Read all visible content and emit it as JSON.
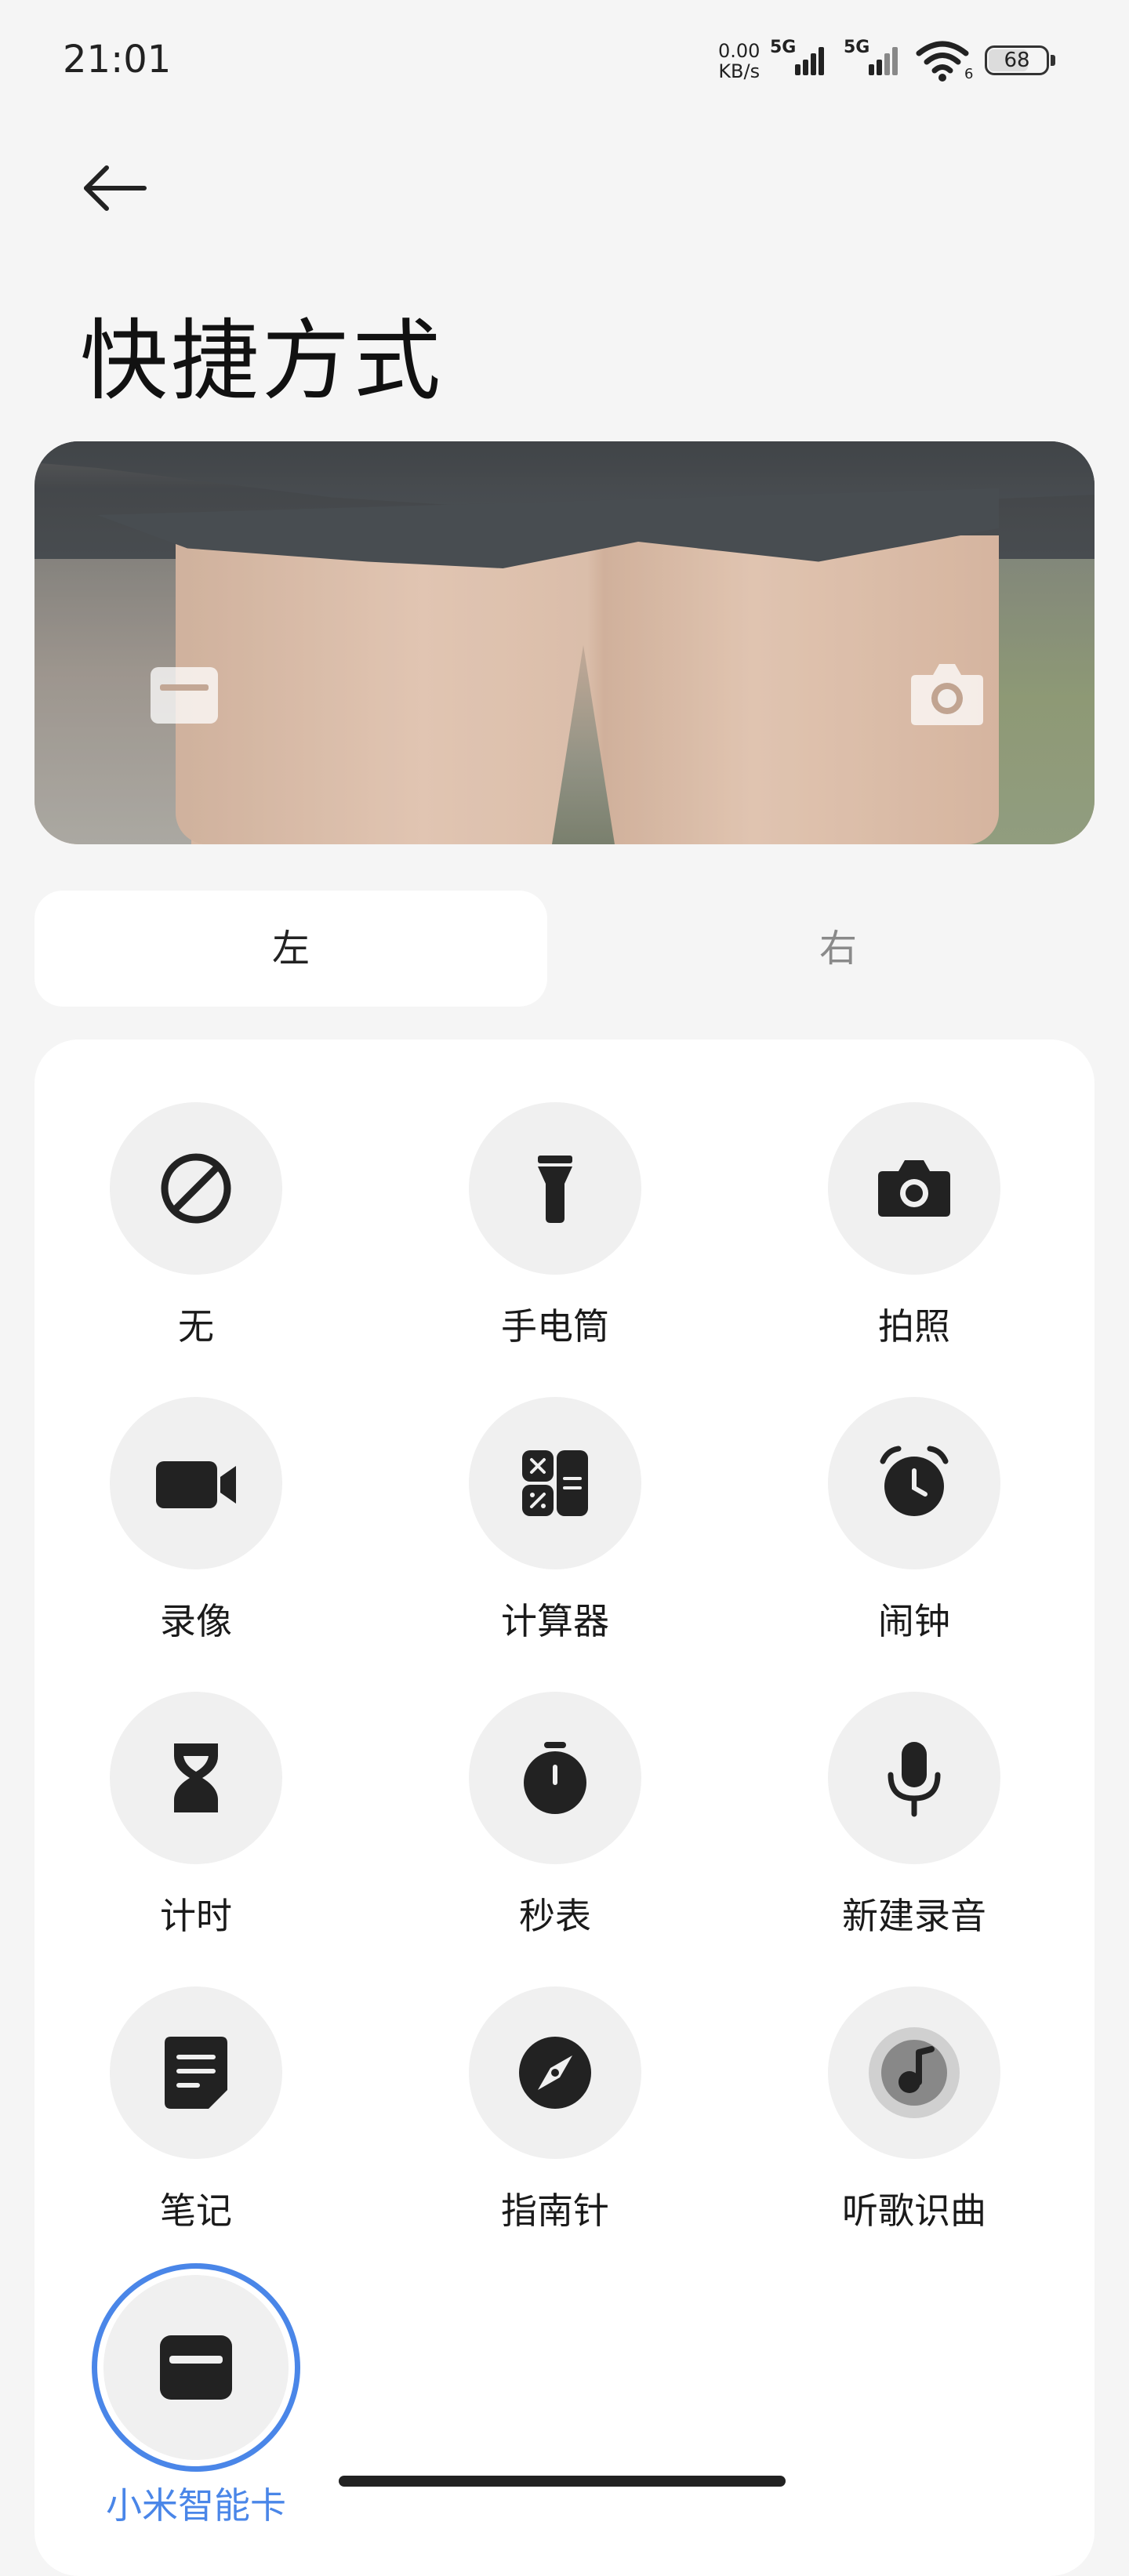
{
  "status_bar": {
    "time": "21:01",
    "net_speed_value": "0.00",
    "net_speed_unit": "KB/s",
    "sim1_label": "5G",
    "sim2_label": "5G",
    "wifi_badge": "6",
    "battery": "68"
  },
  "page": {
    "title": "快捷方式"
  },
  "tabs": [
    {
      "label": "左",
      "selected": true
    },
    {
      "label": "右",
      "selected": false
    }
  ],
  "options": [
    {
      "label": "无",
      "icon": "none-icon"
    },
    {
      "label": "手电筒",
      "icon": "flashlight-icon"
    },
    {
      "label": "拍照",
      "icon": "camera-icon"
    },
    {
      "label": "录像",
      "icon": "video-icon"
    },
    {
      "label": "计算器",
      "icon": "calculator-icon"
    },
    {
      "label": "闹钟",
      "icon": "alarm-icon"
    },
    {
      "label": "计时",
      "icon": "hourglass-icon"
    },
    {
      "label": "秒表",
      "icon": "stopwatch-icon"
    },
    {
      "label": "新建录音",
      "icon": "microphone-icon"
    },
    {
      "label": "笔记",
      "icon": "notes-icon"
    },
    {
      "label": "指南针",
      "icon": "compass-icon"
    },
    {
      "label": "听歌识曲",
      "icon": "music-recognition-icon"
    },
    {
      "label": "小米智能卡",
      "icon": "smart-card-icon",
      "selected": true
    }
  ],
  "colors": {
    "accent": "#4a86e8",
    "icon": "#222222",
    "circle": "#f0f0f0"
  }
}
